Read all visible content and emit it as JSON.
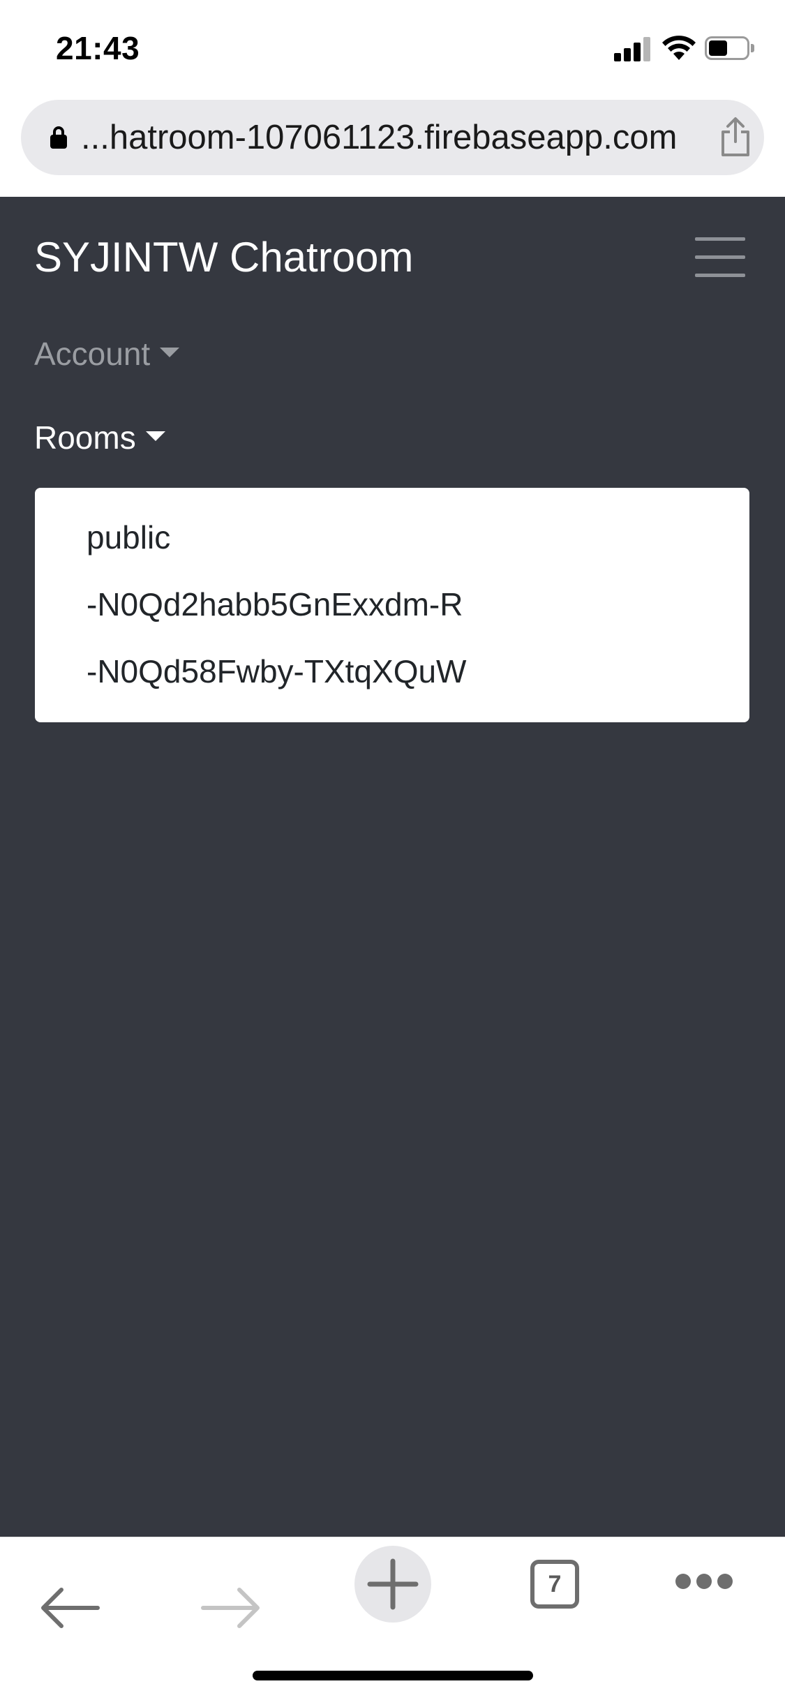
{
  "status_bar": {
    "time": "21:43"
  },
  "browser": {
    "url": "...hatroom-107061123.firebaseapp.com",
    "tab_count": "7"
  },
  "navbar": {
    "brand": "SYJINTW Chatroom",
    "account_label": "Account",
    "rooms_label": "Rooms"
  },
  "rooms": [
    {
      "label": "public"
    },
    {
      "label": "-N0Qd2habb5GnExxdm-R"
    },
    {
      "label": "-N0Qd58Fwby-TXtqXQuW"
    }
  ],
  "colors": {
    "app_background": "#353840",
    "brand_text": "#ffffff",
    "muted_nav_text": "#9a9da2",
    "menu_background": "#ffffff"
  },
  "icons": {
    "lock": "lock-icon",
    "share": "share-icon",
    "hamburger": "hamburger-menu-icon",
    "back": "arrow-left-icon",
    "forward": "arrow-right-icon",
    "new_tab": "plus-icon",
    "tabs": "tabs-icon",
    "more": "ellipsis-icon"
  }
}
